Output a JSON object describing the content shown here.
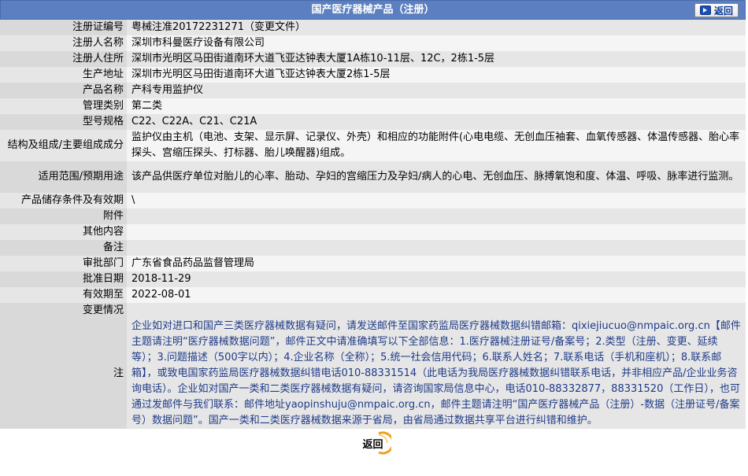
{
  "header": {
    "title": "国产医疗器械产品（注册）",
    "back_label": "返回"
  },
  "rows": [
    {
      "label": "注册证编号",
      "value": "粤械注准20172231271（变更文件）"
    },
    {
      "label": "注册人名称",
      "value": "深圳市科曼医疗设备有限公司"
    },
    {
      "label": "注册人住所",
      "value": "深圳市光明区马田街道南环大道飞亚达钟表大厦1A栋10-11层、12C，2栋1-5层"
    },
    {
      "label": "生产地址",
      "value": "深圳市光明区马田街道南环大道飞亚达钟表大厦2栋1-5层"
    },
    {
      "label": "产品名称",
      "value": "产科专用监护仪"
    },
    {
      "label": "管理类别",
      "value": "第二类"
    },
    {
      "label": "型号规格",
      "value": "C22、C22A、C21、C21A"
    },
    {
      "label": "结构及组成/主要组成成分",
      "value": "监护仪由主机（电池、支架、显示屏、记录仪、外壳）和相应的功能附件(心电电缆、无创血压袖套、血氧传感器、体温传感器、胎心率探头、宫缩压探头、打标器、胎儿唤醒器)组成。"
    },
    {
      "label": "适用范围/预期用途",
      "value": "该产品供医疗单位对胎儿的心率、胎动、孕妇的宫缩压力及孕妇/病人的心电、无创血压、脉搏氧饱和度、体温、呼吸、脉率进行监测。"
    },
    {
      "label": "产品储存条件及有效期",
      "value": "\\"
    },
    {
      "label": "附件",
      "value": ""
    },
    {
      "label": "其他内容",
      "value": ""
    },
    {
      "label": "备注",
      "value": ""
    },
    {
      "label": "审批部门",
      "value": "广东省食品药品监督管理局"
    },
    {
      "label": "批准日期",
      "value": "2018-11-29"
    },
    {
      "label": "有效期至",
      "value": "2022-08-01"
    },
    {
      "label": "变更情况",
      "value": ""
    }
  ],
  "note": {
    "label": "注",
    "text": "企业如对进口和国产三类医疗器械数据有疑问，请发送邮件至国家药监局医疗器械数据纠错邮箱：qixiejiucuo@nmpaic.org.cn【邮件主题请注明“医疗器械数据问题”，邮件正文中请准确填写以下全部信息：1.医疗器械注册证号/备案号；2.类型（注册、变更、延续等）；3.问题描述（500字以内）；4.企业名称（全称）；5.统一社会信用代码；6.联系人姓名；7.联系电话（手机和座机）；8.联系邮箱】，或致电国家药监局医疗器械数据纠错电话010-88331514（此电话为我局医疗器械数据纠错联系电话，并非相应产品/企业业务咨询电话）。企业如对国产一类和二类医疗器械数据有疑问，请咨询国家局信息中心，电话010-88332877，88331520（工作日），也可通过发邮件与我们联系：邮件地址yaopinshuju@nmpaic.org.cn，邮件主题请注明“国产医疗器械产品（注册）-数据（注册证号/备案号）数据问题”。国产一类和二类医疗器械数据来源于省局，由省局通过数据共享平台进行纠错和维护。"
  },
  "footer": {
    "back_label": "返回"
  },
  "colors": {
    "header_bg": "#5b7fc0",
    "row_odd": "#e6e6e6",
    "row_even": "#f5f5f5",
    "notice_text": "#1f3b88",
    "back_ring": "#f0a020"
  }
}
